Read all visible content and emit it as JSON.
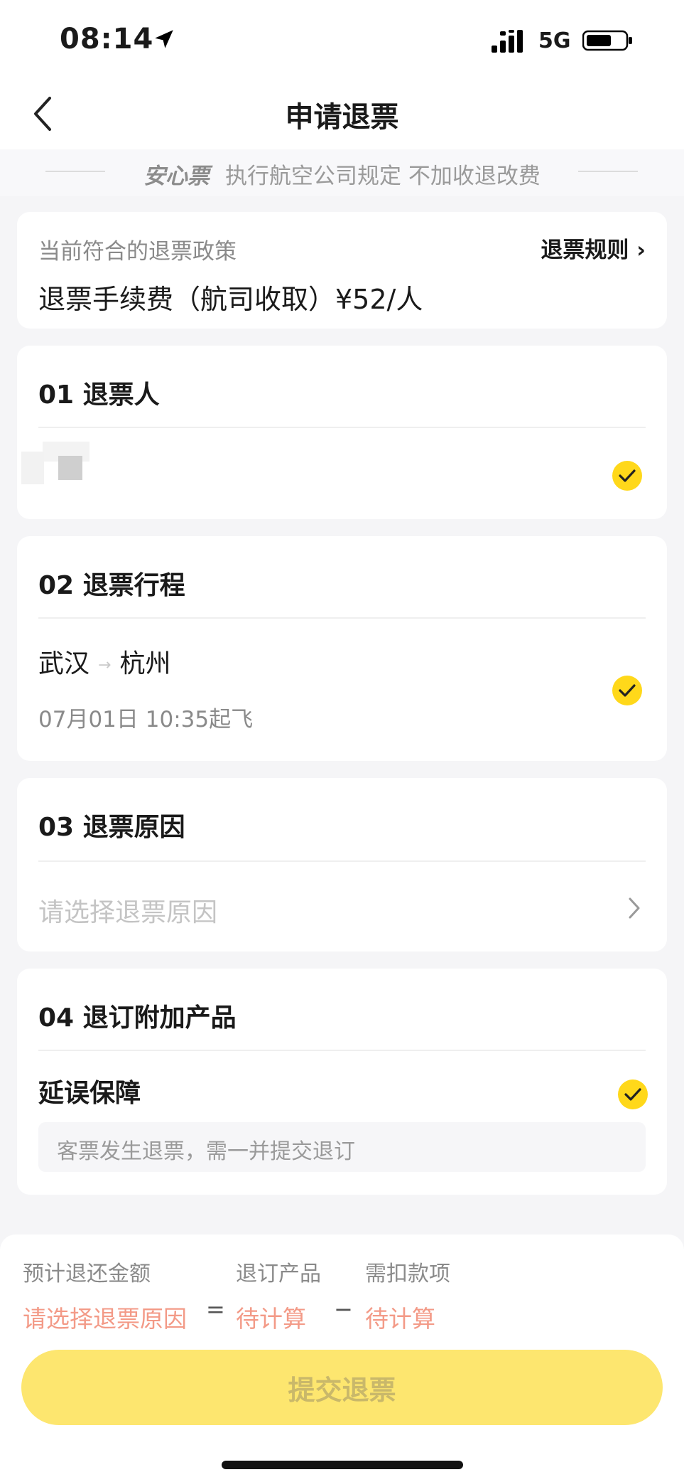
{
  "status_bar": {
    "time": "08:14",
    "network": "5G"
  },
  "nav": {
    "title": "申请退票"
  },
  "banner": {
    "brand": "安心票",
    "text": "执行航空公司规定 不加收退改费"
  },
  "policy": {
    "label": "当前符合的退票政策",
    "rule_link": "退票规则 ›",
    "fee": "退票手续费（航司收取）¥52/人"
  },
  "sections": {
    "passenger": {
      "title": "01  退票人"
    },
    "itinerary": {
      "title": "02  退票行程",
      "from": "武汉",
      "to": "杭州",
      "departure": "07月01日 10:35起飞"
    },
    "reason": {
      "title": "03  退票原因",
      "placeholder": "请选择退票原因"
    },
    "addons": {
      "title": "04  退订附加产品",
      "product_name": "延误保障",
      "note": "客票发生退票，需一并提交退订"
    }
  },
  "summary": {
    "refund_label": "预计退还金额",
    "refund_value": "请选择退票原因",
    "equals": "=",
    "product_label": "退订产品",
    "product_value": "待计算",
    "minus": "−",
    "deduction_label": "需扣款项",
    "deduction_value": "待计算"
  },
  "submit_label": "提交退票",
  "colors": {
    "accent": "#ffd81a",
    "pending_text": "#f39a87",
    "button_disabled": "#fde66f"
  }
}
